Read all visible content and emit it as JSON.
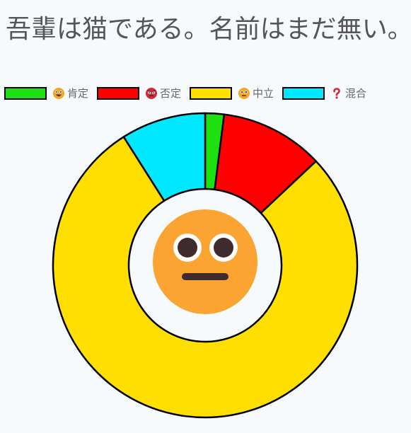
{
  "title": "吾輩は猫である。名前はまだ無い。",
  "chart_data": {
    "type": "doughnut",
    "series": [
      {
        "name": "肯定",
        "value": 2,
        "color": "#1ee011",
        "icon": "grinning-face-icon"
      },
      {
        "name": "否定",
        "value": 11,
        "color": "#ff0000",
        "icon": "angry-face-icon"
      },
      {
        "name": "中立",
        "value": 78,
        "color": "#ffdf00",
        "icon": "neutral-face-icon"
      },
      {
        "name": "混合",
        "value": 9,
        "color": "#00e8ff",
        "icon": "question-mark-icon"
      }
    ],
    "legend_position": "top",
    "center_icon": "flushed-neutral-face-icon"
  }
}
